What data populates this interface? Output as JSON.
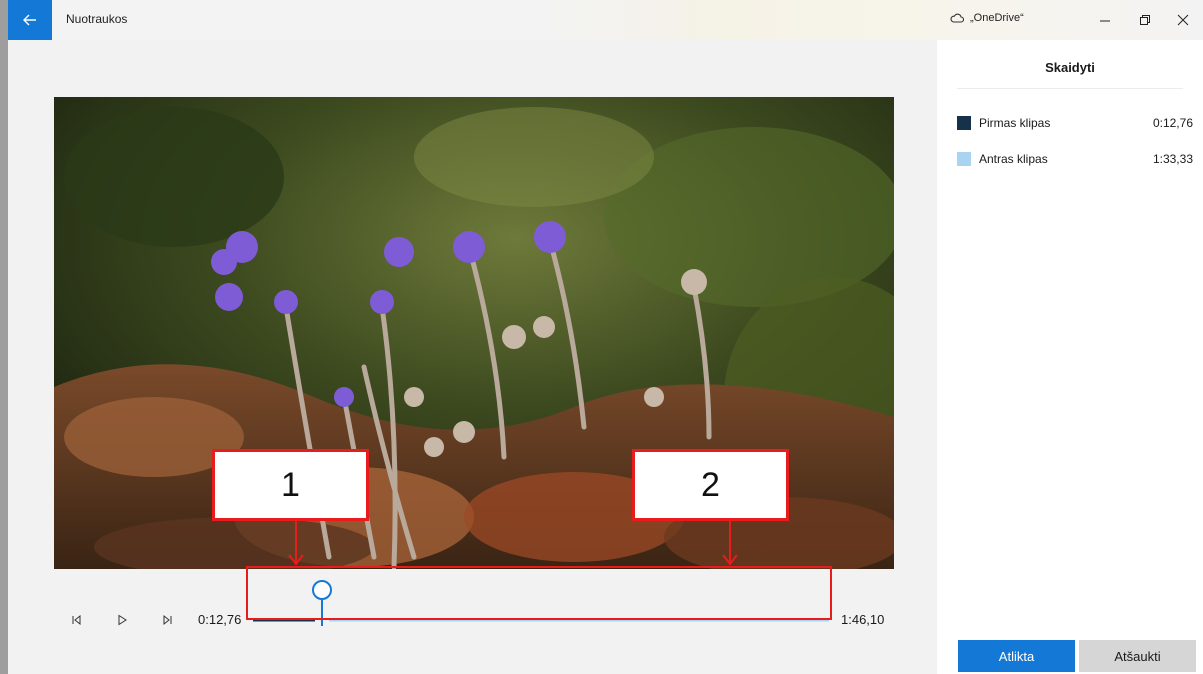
{
  "window": {
    "title": "Nuotraukos",
    "onedrive_label": "„OneDrive“"
  },
  "sidebar": {
    "title": "Skaidyti",
    "clips": [
      {
        "name": "Pirmas klipas",
        "duration": "0:12,76",
        "color": "#16314a"
      },
      {
        "name": "Antras klipas",
        "duration": "1:33,33",
        "color": "#a8d4f2"
      }
    ],
    "done_label": "Atlikta",
    "cancel_label": "Atšaukti"
  },
  "player": {
    "current_time": "0:12,76",
    "total_time": "1:46,10",
    "split_fraction": 0.1202
  },
  "annotations": {
    "callout_1": "1",
    "callout_2": "2",
    "color": "#e81c1c"
  },
  "colors": {
    "accent": "#1479d6",
    "first_clip": "#16314a",
    "second_clip": "#a8d4f2"
  }
}
